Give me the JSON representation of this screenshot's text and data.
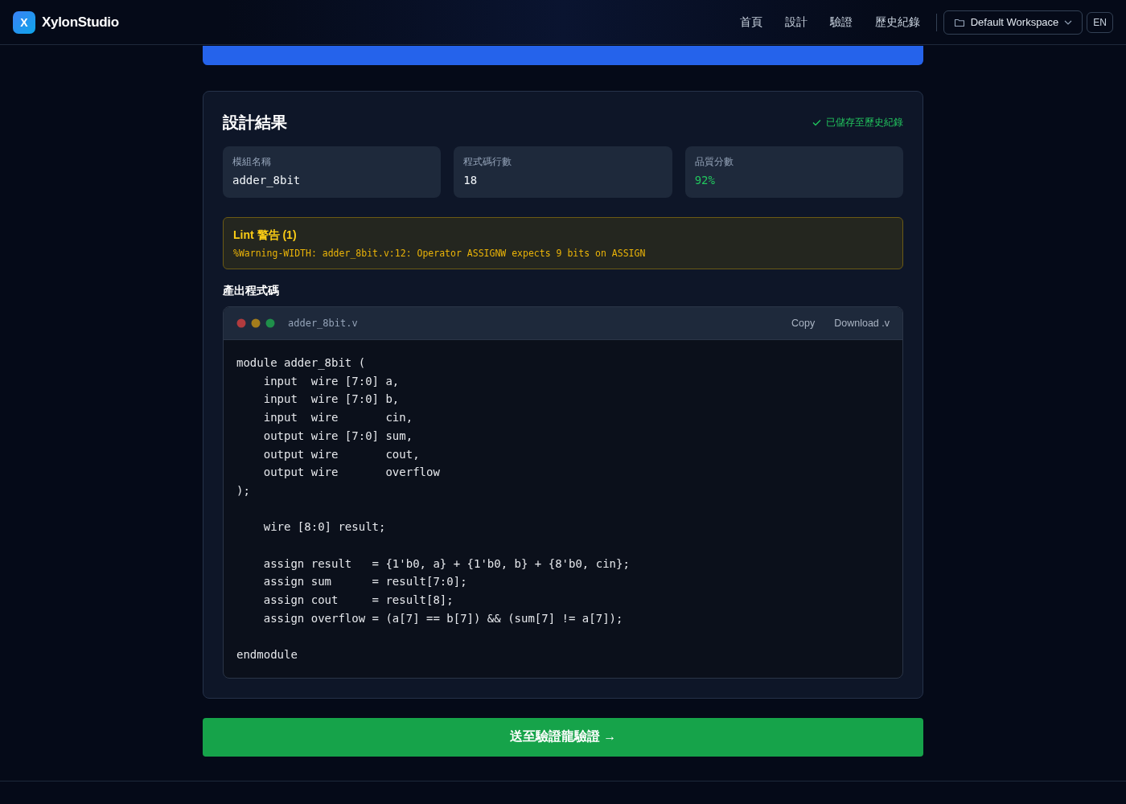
{
  "header": {
    "brand_mark": "X",
    "brand": "XylonStudio",
    "nav": [
      {
        "label": "首頁",
        "selected": false
      },
      {
        "label": "設計",
        "selected": false
      },
      {
        "label": "驗證",
        "selected": false
      },
      {
        "label": "歷史紀錄",
        "selected": false
      }
    ],
    "workspace": "Default Workspace",
    "language": "EN"
  },
  "result": {
    "title": "設計結果",
    "saved_note": "已儲存至歷史紀錄",
    "stats": [
      {
        "label": "模組名稱",
        "value": "adder_8bit",
        "kind": "plain"
      },
      {
        "label": "程式碼行數",
        "value": "18",
        "kind": "plain"
      },
      {
        "label": "品質分數",
        "value": "92%",
        "kind": "good"
      }
    ],
    "lint": {
      "title": "Lint 警告 (1)",
      "messages": [
        "%Warning-WIDTH: adder_8bit.v:12: Operator ASSIGNW expects 9 bits on ASSIGN"
      ]
    },
    "code_heading": "產出程式碼",
    "code": {
      "filename": "adder_8bit.v",
      "actions": [
        "Copy",
        "Download .v"
      ],
      "text": "module adder_8bit (\n    input  wire [7:0] a,\n    input  wire [7:0] b,\n    input  wire       cin,\n    output wire [7:0] sum,\n    output wire       cout,\n    output wire       overflow\n);\n\n    wire [8:0] result;\n\n    assign result   = {1'b0, a} + {1'b0, b} + {8'b0, cin};\n    assign sum      = result[7:0];\n    assign cout     = result[8];\n    assign overflow = (a[7] == b[7]) && (sum[7] != a[7]);\n\nendmodule"
    }
  },
  "verify_button": "送至驗證龍驗證 →"
}
